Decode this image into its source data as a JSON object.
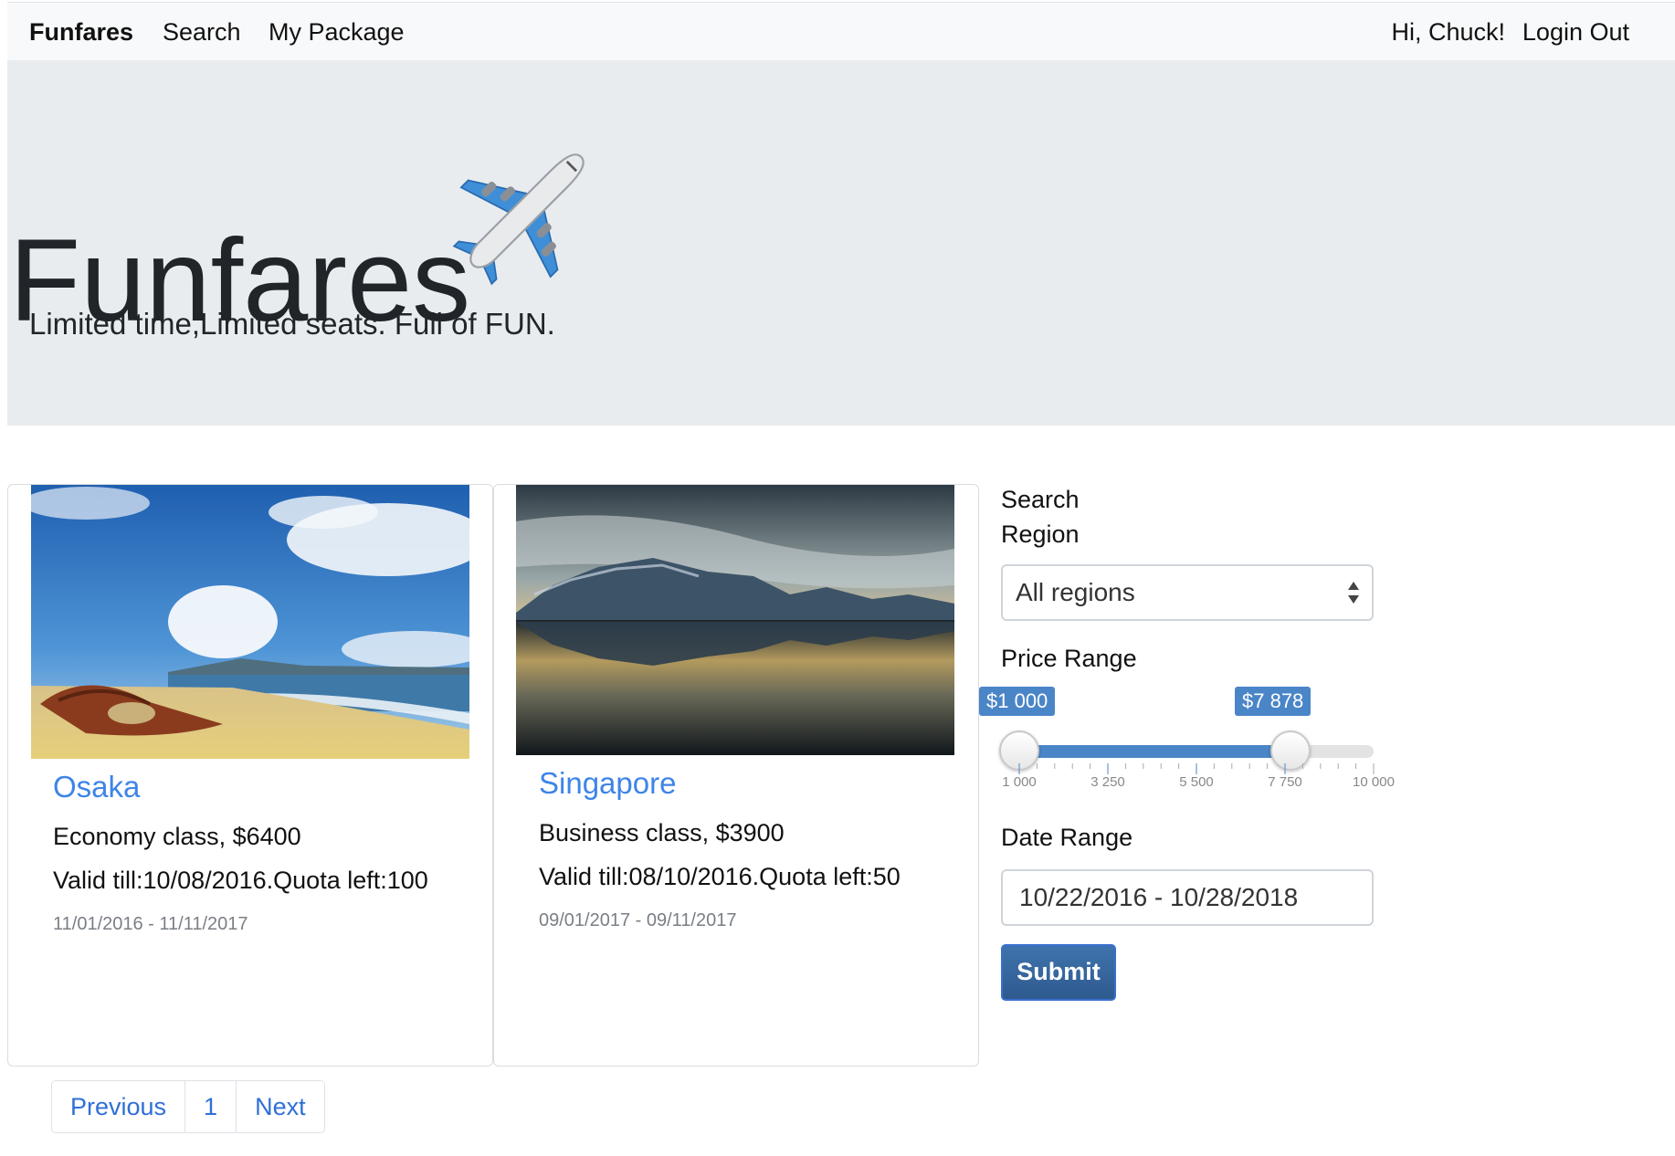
{
  "navbar": {
    "brand": "Funfares",
    "search": "Search",
    "package": "My Package",
    "greeting": "Hi, Chuck!",
    "logout": "Login Out"
  },
  "jumbotron": {
    "title": "Funfares",
    "icon": "airplane-icon",
    "lead": "Limited time,Limited seats. Full of FUN."
  },
  "cards": [
    {
      "title": "Osaka",
      "class_price": "Economy class, $6400",
      "validity": "Valid till:10/08/2016.Quota left:100",
      "dates": "11/01/2016 - 11/11/2017",
      "image": "beach-boat-photo"
    },
    {
      "title": "Singapore",
      "class_price": "Business class, $3900",
      "validity": "Valid till:08/10/2016.Quota left:50",
      "dates": "09/01/2017 - 09/11/2017",
      "image": "lake-mountain-reflection-photo"
    }
  ],
  "pagination": {
    "previous": "Previous",
    "page": "1",
    "next": "Next"
  },
  "search_form": {
    "search_label": "Search",
    "region_label": "Region",
    "region_selected": "All regions",
    "price_label": "Price Range",
    "price_min_label": "$1 000",
    "price_max_label": "$7 878",
    "price_min": 1000,
    "price_max": 7878,
    "slider_range": [
      1000,
      10000
    ],
    "tick_labels": [
      "1 000",
      "3 250",
      "5 500",
      "7 750",
      "10 000"
    ],
    "date_label": "Date Range",
    "date_value": "10/22/2016 - 10/28/2018",
    "submit": "Submit"
  },
  "colors": {
    "link": "#3e84e8",
    "slider_accent": "#4a85c7",
    "button": "#2e5a8e",
    "jumbotron_bg": "#e9ecef"
  }
}
